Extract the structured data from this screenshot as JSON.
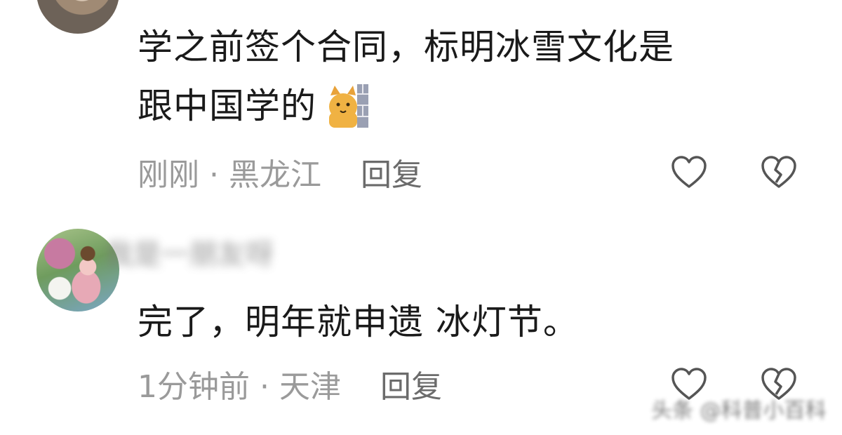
{
  "comments": [
    {
      "text_line1": "学之前签个合同，标明冰雪文化是",
      "text_line2": "跟中国学的",
      "emoji": "cat-peeking-wall-emoji",
      "time": "刚刚",
      "separator": "·",
      "location": "黑龙江",
      "reply_label": "回复"
    },
    {
      "username": "我是一朋友呀",
      "text": "完了，明年就申遗 冰灯节。",
      "time": "1分钟前",
      "separator": "·",
      "location": "天津",
      "reply_label": "回复"
    }
  ],
  "watermark_text": "头条 @科普小百科",
  "icons": [
    "heart-icon",
    "broken-heart-icon"
  ],
  "colors": {
    "text": "#1a1a1a",
    "meta": "#9a9a9a",
    "reply": "#6b6b6b",
    "icon_stroke": "#555555"
  }
}
